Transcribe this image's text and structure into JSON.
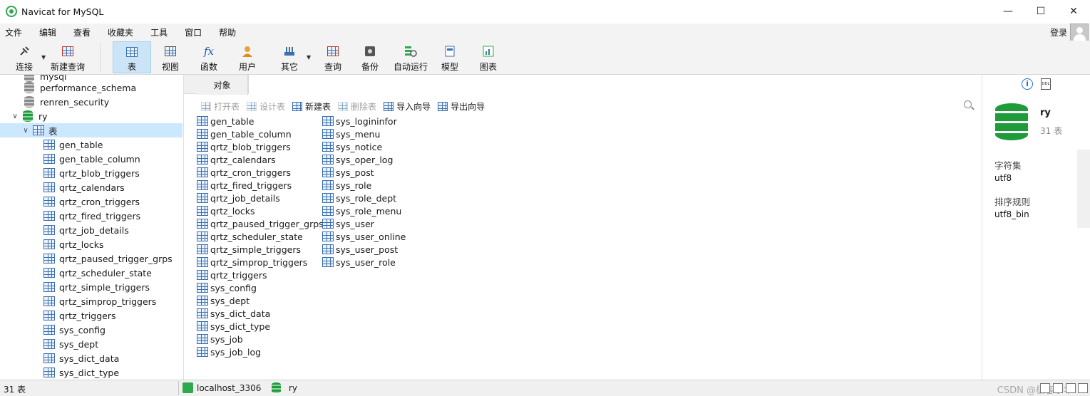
{
  "window": {
    "title": "Navicat for MySQL",
    "minimize": "—",
    "maximize": "☐",
    "close": "✕"
  },
  "menu": [
    "文件",
    "编辑",
    "查看",
    "收藏夹",
    "工具",
    "窗口",
    "帮助"
  ],
  "login": "登录",
  "toolbar": {
    "connect": "连接",
    "new_query": "新建查询",
    "table": "表",
    "view": "视图",
    "function": "函数",
    "user": "用户",
    "other": "其它",
    "query": "查询",
    "backup": "备份",
    "automation": "自动运行",
    "model": "模型",
    "chart": "图表",
    "function_icon": "fx"
  },
  "sidebar": {
    "partial_top": "mysql",
    "databases": [
      "performance_schema",
      "renren_security",
      "ry"
    ],
    "tables_node": "表",
    "tables": [
      "gen_table",
      "gen_table_column",
      "qrtz_blob_triggers",
      "qrtz_calendars",
      "qrtz_cron_triggers",
      "qrtz_fired_triggers",
      "qrtz_job_details",
      "qrtz_locks",
      "qrtz_paused_trigger_grps",
      "qrtz_scheduler_state",
      "qrtz_simple_triggers",
      "qrtz_simprop_triggers",
      "qrtz_triggers",
      "sys_config",
      "sys_dept",
      "sys_dict_data",
      "sys_dict_type"
    ]
  },
  "main": {
    "tab": "对象",
    "actions": {
      "open": "打开表",
      "design": "设计表",
      "new": "新建表",
      "delete": "删除表",
      "import": "导入向导",
      "export": "导出向导"
    },
    "col1": [
      "gen_table",
      "gen_table_column",
      "qrtz_blob_triggers",
      "qrtz_calendars",
      "qrtz_cron_triggers",
      "qrtz_fired_triggers",
      "qrtz_job_details",
      "qrtz_locks",
      "qrtz_paused_trigger_grps",
      "qrtz_scheduler_state",
      "qrtz_simple_triggers",
      "qrtz_simprop_triggers",
      "qrtz_triggers",
      "sys_config",
      "sys_dept",
      "sys_dict_data",
      "sys_dict_type",
      "sys_job",
      "sys_job_log"
    ],
    "col2": [
      "sys_logininfor",
      "sys_menu",
      "sys_notice",
      "sys_oper_log",
      "sys_post",
      "sys_role",
      "sys_role_dept",
      "sys_role_menu",
      "sys_user",
      "sys_user_online",
      "sys_user_post",
      "sys_user_role"
    ]
  },
  "info": {
    "ddl_label": "DDL",
    "name": "ry",
    "count": "31 表",
    "charset_label": "字符集",
    "charset": "utf8",
    "collation_label": "排序规则",
    "collation": "utf8_bin"
  },
  "status": {
    "count": "31 表",
    "connection": "localhost_3306",
    "database": "ry",
    "watermark": "CSDN @极客李华"
  }
}
